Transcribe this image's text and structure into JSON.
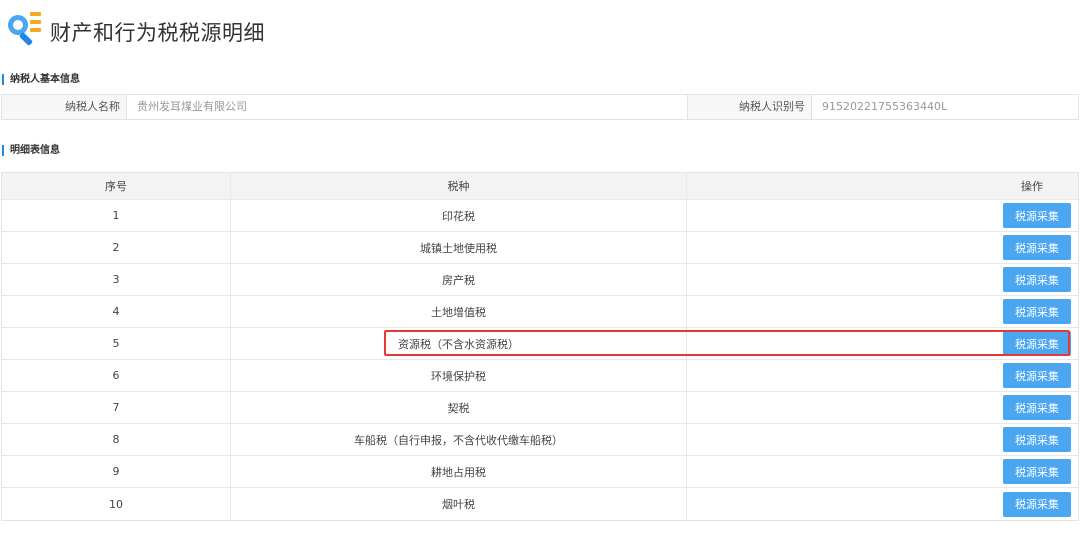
{
  "page": {
    "title": "财产和行为税税源明细"
  },
  "taxpayer_section": {
    "title": "纳税人基本信息",
    "name_label": "纳税人名称",
    "name_value": "贵州发耳煤业有限公司",
    "id_label": "纳税人识别号",
    "id_value": "91520221755363440L"
  },
  "detail_section": {
    "title": "明细表信息",
    "columns": [
      "序号",
      "税种",
      "",
      "操作"
    ],
    "action_label": "税源采集",
    "rows": [
      {
        "no": "1",
        "tax": "印花税"
      },
      {
        "no": "2",
        "tax": "城镇土地使用税"
      },
      {
        "no": "3",
        "tax": "房产税"
      },
      {
        "no": "4",
        "tax": "土地增值税"
      },
      {
        "no": "5",
        "tax": "资源税（不含水资源税）"
      },
      {
        "no": "6",
        "tax": "环境保护税"
      },
      {
        "no": "7",
        "tax": "契税"
      },
      {
        "no": "8",
        "tax": "车船税（自行申报，不含代收代缴车船税）"
      },
      {
        "no": "9",
        "tax": "耕地占用税"
      },
      {
        "no": "10",
        "tax": "烟叶税"
      }
    ]
  },
  "colors": {
    "accent": "#1e88e5",
    "button": "#4aa6f0",
    "highlight": "#e53935"
  },
  "icons": {
    "logo": "search-list-icon"
  }
}
